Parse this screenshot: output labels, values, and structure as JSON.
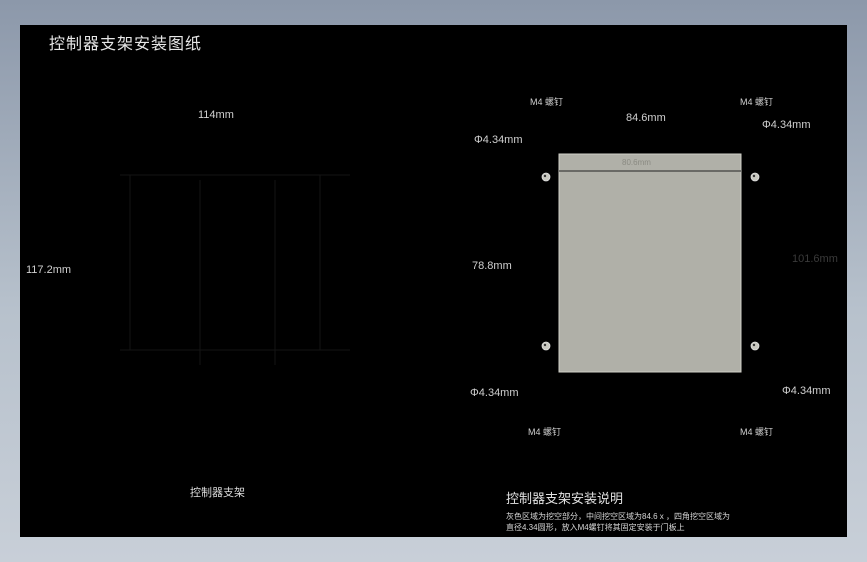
{
  "title": "控制器支架安装图纸",
  "left_view": {
    "width_label": "114mm",
    "height_label": "117.2mm",
    "caption": "控制器支架"
  },
  "right_view": {
    "screw_top_left": "M4 螺钉",
    "screw_top_right": "M4 螺钉",
    "screw_bottom_left": "M4 螺钉",
    "screw_bottom_right": "M4 螺钉",
    "hole_top_left": "Φ4.34mm",
    "hole_top_right": "Φ4.34mm",
    "hole_bottom_left": "Φ4.34mm",
    "hole_bottom_right": "Φ4.34mm",
    "width_label": "84.6mm",
    "inner_width_label": "80.6mm",
    "height_left_label": "78.8mm",
    "height_right_label": "101.6mm"
  },
  "notes": {
    "title": "控制器支架安装说明",
    "line1": "灰色区域为挖空部分，中间挖空区域为84.6 x              ，四角挖空区域为",
    "line2": "直径4.34圆形，放入M4螺钉将其固定安装于门板上"
  },
  "colors": {
    "background": "#000000",
    "cutout_fill": "#b0b0a8",
    "frame": "#000000"
  }
}
